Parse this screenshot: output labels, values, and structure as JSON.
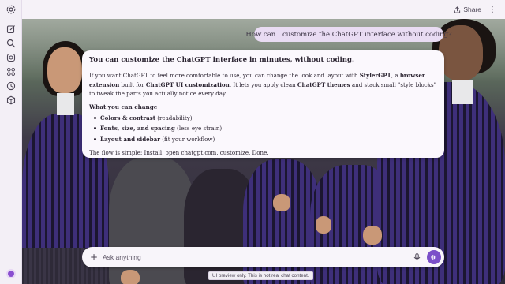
{
  "rail": {
    "icons": [
      "settings-icon",
      "new-chat-icon",
      "search-icon",
      "library-icon",
      "apps-icon",
      "history-icon",
      "package-icon"
    ]
  },
  "topbar": {
    "share_label": "Share",
    "more_label": "⋮"
  },
  "chat": {
    "user_message": "How can I customize the ChatGPT interface without coding?",
    "reply": {
      "heading": "You can customize the ChatGPT interface in minutes, without coding.",
      "intro_1": "If you want ChatGPT to feel more comfortable to use, you can change the look and layout with ",
      "intro_brand": "StylerGPT",
      "intro_2": ", a ",
      "intro_ext": "browser extension",
      "intro_3": " built for ",
      "intro_custom": "ChatGPT UI customization",
      "intro_4": ". It lets you apply clean ",
      "intro_themes": "ChatGPT themes",
      "intro_5": " and stack small \"style blocks\" to tweak the parts you actually notice every day.",
      "section_title": "What you can change",
      "items": [
        {
          "bold": "Colors & contrast",
          "rest": " (readability)"
        },
        {
          "bold": "Fonts, size, and spacing",
          "rest": " (less eye strain)"
        },
        {
          "bold": "Layout and sidebar",
          "rest": " (fit your workflow)"
        }
      ],
      "flow": "The flow is simple: Install, open chatgpt.com, customize. Done."
    }
  },
  "composer": {
    "placeholder": "Ask anything",
    "plus_label": "+"
  },
  "notice": "UI preview only. This is not real chat content.",
  "colors": {
    "accent": "#7b4fc9",
    "user_bubble": "#e9dcf3",
    "card": "#fbf8fd",
    "uniform_purple": "#3e2f7a"
  }
}
